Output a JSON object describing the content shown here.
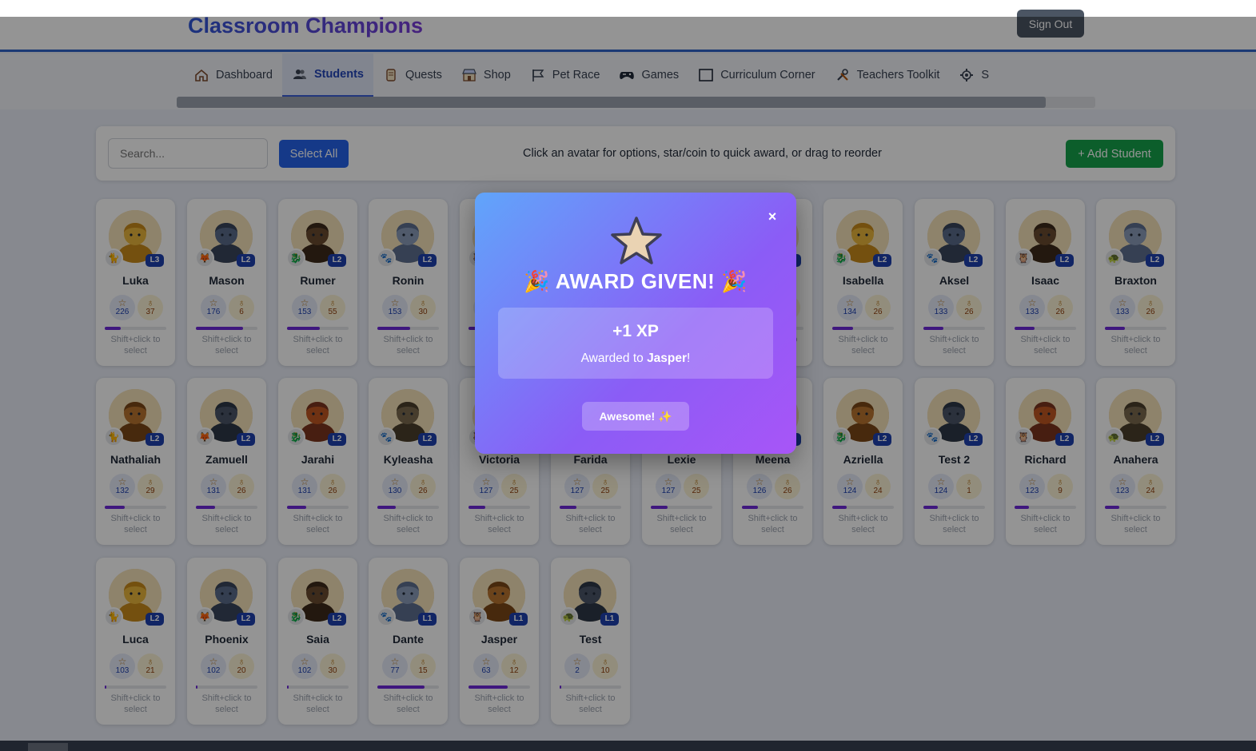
{
  "app": {
    "title": "Classroom Champions",
    "sign_out_label": "Sign Out"
  },
  "nav": {
    "tabs": [
      {
        "label": "Dashboard",
        "icon": "house-icon",
        "active": false
      },
      {
        "label": "Students",
        "icon": "users-icon",
        "active": true
      },
      {
        "label": "Quests",
        "icon": "scroll-icon",
        "active": false
      },
      {
        "label": "Shop",
        "icon": "shop-icon",
        "active": false
      },
      {
        "label": "Pet Race",
        "icon": "flag-icon",
        "active": false
      },
      {
        "label": "Games",
        "icon": "gamepad-icon",
        "active": false
      },
      {
        "label": "Curriculum Corner",
        "icon": "book-icon",
        "active": false
      },
      {
        "label": "Teachers Toolkit",
        "icon": "tools-icon",
        "active": false
      },
      {
        "label": "S",
        "icon": "gear-icon",
        "active": false
      }
    ]
  },
  "toolbar": {
    "search_placeholder": "Search...",
    "select_all_label": "Select All",
    "hint": "Click an avatar for options, star/coin to quick award, or drag to reorder",
    "add_student_label": "+ Add Student"
  },
  "card_hint": "Shift+click to select",
  "colors": {
    "accent": "#2f63c8",
    "select_all": "#2563eb",
    "add_student": "#16a34a",
    "level_badge": "#1e40af",
    "xp_bar": "#6d28d9"
  },
  "students": [
    {
      "name": "Luka",
      "level": "L3",
      "xp": "226",
      "coins": "37",
      "progress": 0.26
    },
    {
      "name": "Mason",
      "level": "L2",
      "xp": "176",
      "coins": "6",
      "progress": 0.76
    },
    {
      "name": "Rumer",
      "level": "L2",
      "xp": "153",
      "coins": "55",
      "progress": 0.53
    },
    {
      "name": "Ronin",
      "level": "L2",
      "xp": "153",
      "coins": "30",
      "progress": 0.53
    },
    {
      "name": "",
      "level": "",
      "xp": "",
      "coins": "",
      "progress": 0.4
    },
    {
      "name": "",
      "level": "",
      "xp": "",
      "coins": "",
      "progress": 0.4
    },
    {
      "name": "",
      "level": "",
      "xp": "",
      "coins": "",
      "progress": 0.4
    },
    {
      "name": "",
      "level": "L2",
      "xp": "",
      "coins": "",
      "progress": 0.4
    },
    {
      "name": "Isabella",
      "level": "L2",
      "xp": "134",
      "coins": "26",
      "progress": 0.34
    },
    {
      "name": "Aksel",
      "level": "L2",
      "xp": "133",
      "coins": "26",
      "progress": 0.33
    },
    {
      "name": "Isaac",
      "level": "L2",
      "xp": "133",
      "coins": "26",
      "progress": 0.33
    },
    {
      "name": "Braxton",
      "level": "L2",
      "xp": "133",
      "coins": "26",
      "progress": 0.33
    },
    {
      "name": "Nathaliah",
      "level": "L2",
      "xp": "132",
      "coins": "29",
      "progress": 0.32
    },
    {
      "name": "Zamuell",
      "level": "L2",
      "xp": "131",
      "coins": "26",
      "progress": 0.31
    },
    {
      "name": "Jarahi",
      "level": "L2",
      "xp": "131",
      "coins": "26",
      "progress": 0.31
    },
    {
      "name": "Kyleasha",
      "level": "L2",
      "xp": "130",
      "coins": "26",
      "progress": 0.3
    },
    {
      "name": "Victoria",
      "level": "L2",
      "xp": "127",
      "coins": "25",
      "progress": 0.27
    },
    {
      "name": "Farida",
      "level": "L2",
      "xp": "127",
      "coins": "25",
      "progress": 0.27
    },
    {
      "name": "Lexie",
      "level": "L2",
      "xp": "127",
      "coins": "25",
      "progress": 0.27
    },
    {
      "name": "Meena",
      "level": "L2",
      "xp": "126",
      "coins": "26",
      "progress": 0.26
    },
    {
      "name": "Azriella",
      "level": "L2",
      "xp": "124",
      "coins": "24",
      "progress": 0.24
    },
    {
      "name": "Test 2",
      "level": "L2",
      "xp": "124",
      "coins": "1",
      "progress": 0.24
    },
    {
      "name": "Richard",
      "level": "L2",
      "xp": "123",
      "coins": "9",
      "progress": 0.23
    },
    {
      "name": "Anahera",
      "level": "L2",
      "xp": "123",
      "coins": "24",
      "progress": 0.23
    },
    {
      "name": "Luca",
      "level": "L2",
      "xp": "103",
      "coins": "21",
      "progress": 0.03
    },
    {
      "name": "Phoenix",
      "level": "L2",
      "xp": "102",
      "coins": "20",
      "progress": 0.02
    },
    {
      "name": "Saia",
      "level": "L2",
      "xp": "102",
      "coins": "30",
      "progress": 0.02
    },
    {
      "name": "Dante",
      "level": "L1",
      "xp": "77",
      "coins": "15",
      "progress": 0.77
    },
    {
      "name": "Jasper",
      "level": "L1",
      "xp": "63",
      "coins": "12",
      "progress": 0.63
    },
    {
      "name": "Test",
      "level": "L1",
      "xp": "2",
      "coins": "10",
      "progress": 0.02
    }
  ],
  "modal": {
    "title": "AWARD GIVEN!",
    "amount": "+1 XP",
    "awarded_prefix": "Awarded to ",
    "awarded_name": "Jasper",
    "awarded_suffix": "!",
    "confirm_label": "Awesome! ✨",
    "close_label": "×"
  }
}
